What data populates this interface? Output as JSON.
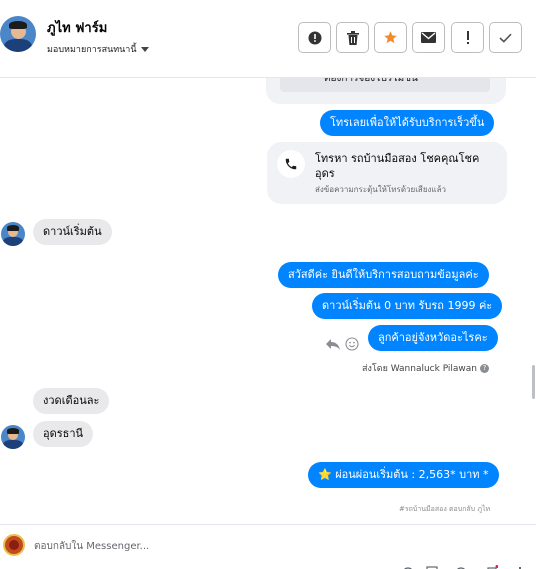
{
  "header": {
    "name": "ภูไท ฟาร์ม",
    "assign_label": "มอบหมายการสนทนานี้",
    "toolbar": [
      {
        "name": "report-button",
        "icon": "alert-circle-icon"
      },
      {
        "name": "delete-button",
        "icon": "trash-icon"
      },
      {
        "name": "star-button",
        "icon": "star-icon"
      },
      {
        "name": "mark-unread-button",
        "icon": "envelope-icon"
      },
      {
        "name": "spam-button",
        "icon": "exclamation-icon"
      },
      {
        "name": "done-button",
        "icon": "check-icon"
      }
    ]
  },
  "messages": {
    "card_top_text": "ต้องการจองโปรโมชั่น",
    "call_now": "โทรเลยเพื่อให้ได้รับบริการเร็วขึ้น",
    "call_card_title": "โทรหา รถบ้านมือสอง โชคคุณโชคอุดร",
    "call_card_sub": "ส่งข้อความกระตุ้นให้โทรด้วยเสียงแล้ว",
    "in_1": "ดาวน์เริ่มต้น",
    "out_1": "สวัสดีค่ะ  ยินดีให้บริการสอบถามข้อมูลค่ะ",
    "out_2": "ดาวน์เริ่มต้น 0 บาท รับรถ 1999 ค่ะ",
    "out_3": "ลูกค้าอยู่จังหวัดอะไรคะ",
    "sent_by": "ส่งโดย Wannaluck Pilawan",
    "in_2": "งวดเดือนละ",
    "in_3": "อุดรธานี",
    "out_4": "⭐ ผ่อนผ่อนเริ่มต้น : 2,563* บาท *",
    "footnote": "#รถบ้านมือสอง ตอบกลับ ภูไท"
  },
  "footer": {
    "reply_placeholder": "ตอบกลับใน Messenger..."
  },
  "colors": {
    "accent": "#0084ff",
    "incoming_bubble": "#e9e9eb",
    "star": "#f28b2c"
  }
}
